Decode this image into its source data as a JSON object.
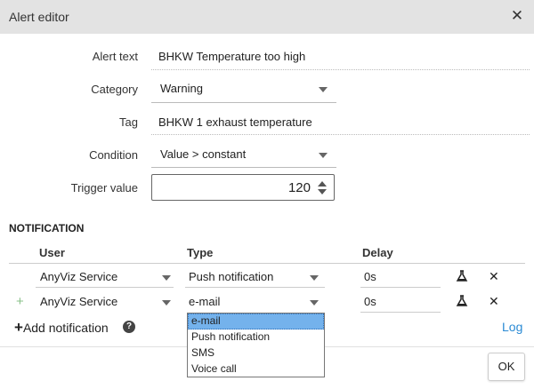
{
  "dialog": {
    "title": "Alert editor"
  },
  "form": {
    "alert_text_label": "Alert text",
    "alert_text_value": "BHKW Temperature too high",
    "category_label": "Category",
    "category_value": "Warning",
    "tag_label": "Tag",
    "tag_value": "BHKW 1 exhaust temperature",
    "condition_label": "Condition",
    "condition_value": "Value > constant",
    "trigger_label": "Trigger value",
    "trigger_value": "120"
  },
  "notification": {
    "section_title": "NOTIFICATION",
    "columns": {
      "user": "User",
      "type": "Type",
      "delay": "Delay"
    },
    "rows": [
      {
        "user": "AnyViz Service",
        "type": "Push notification",
        "delay": "0s"
      },
      {
        "user": "AnyViz Service",
        "type": "e-mail",
        "delay": "0s"
      }
    ],
    "add_label": "Add notification",
    "log_label": "Log"
  },
  "type_dropdown": {
    "options": [
      "e-mail",
      "Push notification",
      "SMS",
      "Voice call"
    ],
    "selected": "e-mail"
  },
  "footer": {
    "ok_label": "OK"
  },
  "colors": {
    "titlebar_bg": "#e3e3e3",
    "accent_link": "#2a8ad4",
    "dropdown_highlight": "#74b2ec",
    "add_row_plus": "#8ac18a"
  },
  "icons": [
    "close-icon",
    "caret-down-icon",
    "spin-up-icon",
    "spin-down-icon",
    "plus-icon",
    "flask-icon",
    "delete-icon",
    "help-icon"
  ]
}
